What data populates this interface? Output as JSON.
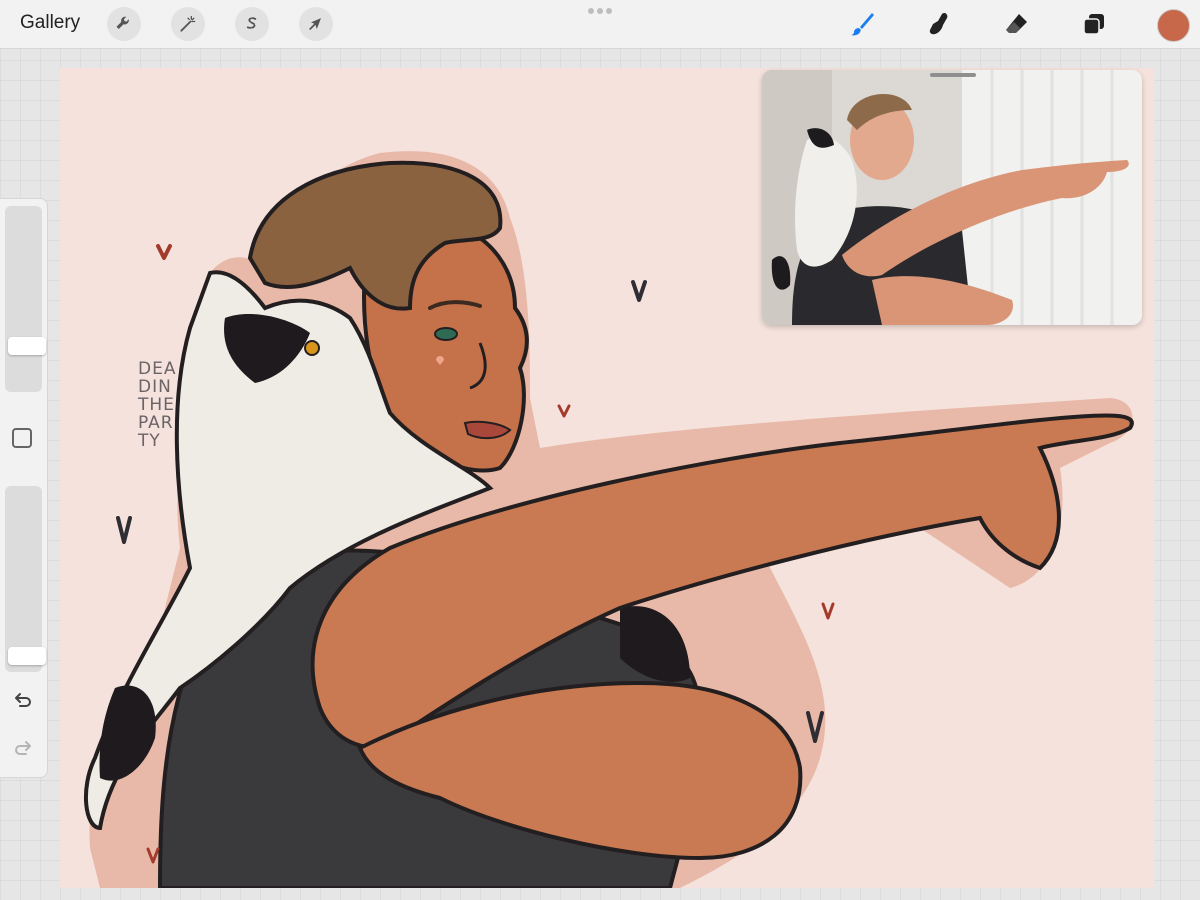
{
  "app": {
    "gallery_label": "Gallery"
  },
  "toolbar": {
    "left_tools": [
      {
        "name": "actions",
        "icon": "wrench-icon"
      },
      {
        "name": "adjustments",
        "icon": "magic-wand-icon"
      },
      {
        "name": "selection",
        "icon": "selection-s-icon"
      },
      {
        "name": "transform",
        "icon": "arrow-cursor-icon"
      }
    ],
    "right_tools": [
      {
        "name": "brush",
        "icon": "brush-icon",
        "active": true
      },
      {
        "name": "smudge",
        "icon": "smudge-finger-icon"
      },
      {
        "name": "eraser",
        "icon": "eraser-icon"
      },
      {
        "name": "layers",
        "icon": "layers-icon"
      }
    ],
    "current_color": "#c8684a",
    "active_tool_color": "#1a7df0"
  },
  "sidebar": {
    "brush_size_level": 0.78,
    "opacity_level": 0.96,
    "undo_icon": "undo-icon",
    "redo_icon": "redo-icon"
  },
  "canvas": {
    "background": "#f5e2dc",
    "signature_lines": [
      "DEA",
      "DIN",
      "THE",
      "PAR",
      "TY"
    ]
  },
  "reference": {
    "type": "photo-reference",
    "visible": true
  }
}
